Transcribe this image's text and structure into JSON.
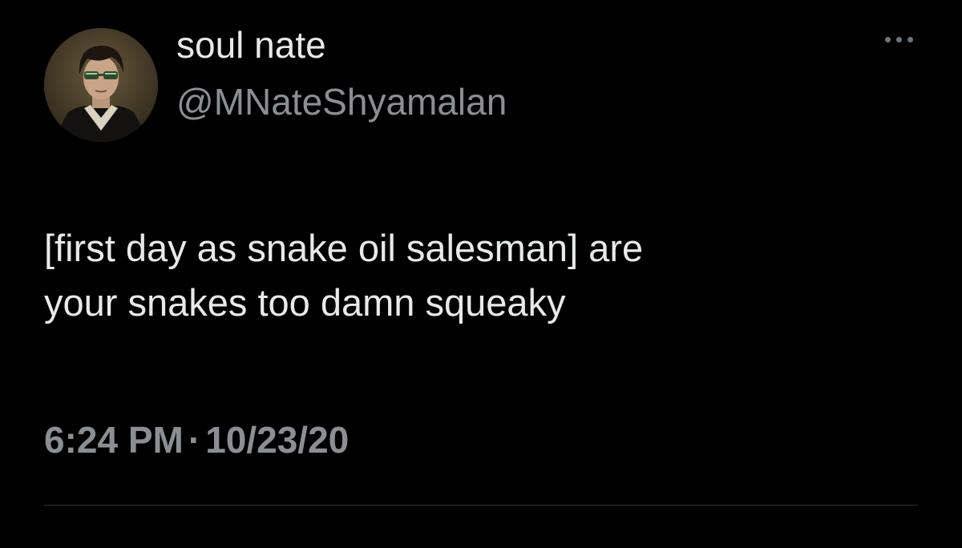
{
  "tweet": {
    "author": {
      "display_name": "soul nate",
      "handle": "@MNateShyamalan",
      "avatar_icon": "portrait-avatar"
    },
    "more_icon": "ellipsis-icon",
    "text_lines": [
      "[first day as snake oil salesman] are",
      "your snakes too damn squeaky"
    ],
    "time": "6:24 PM",
    "separator": "·",
    "date": "10/23/20"
  },
  "colors": {
    "background": "#000000",
    "primary_text": "#e7e9ea",
    "secondary_text": "#8b8f94",
    "divider": "#2f3336"
  }
}
